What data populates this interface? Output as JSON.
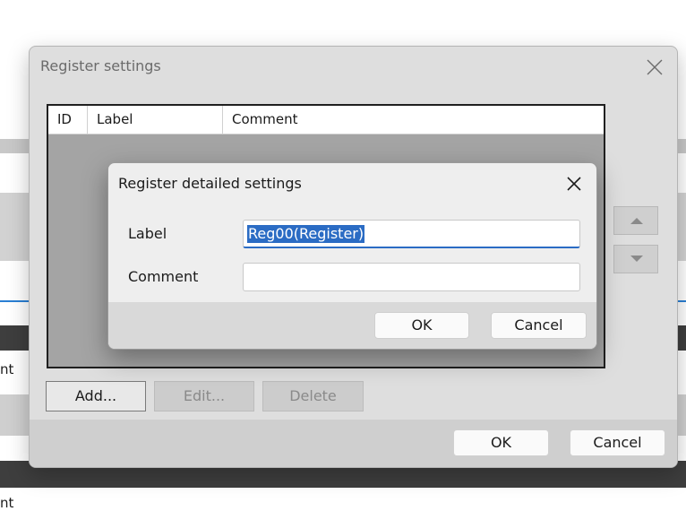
{
  "background": {
    "fragment_text_1": "nt",
    "fragment_text_2": "nt"
  },
  "outer_dialog": {
    "title": "Register settings",
    "close_icon": "close-icon",
    "table": {
      "columns": [
        "ID",
        "Label",
        "Comment"
      ]
    },
    "buttons": {
      "add": "Add...",
      "edit": "Edit...",
      "delete": "Delete",
      "ok": "OK",
      "cancel": "Cancel"
    },
    "side_buttons": {
      "up_icon": "triangle-up-icon",
      "down_icon": "triangle-down-icon"
    }
  },
  "inner_dialog": {
    "title": "Register detailed settings",
    "close_icon": "close-icon",
    "label_caption": "Label",
    "label_value": "Reg00(Register)",
    "comment_caption": "Comment",
    "comment_value": "",
    "ok": "OK",
    "cancel": "Cancel"
  },
  "colors": {
    "selection": "#2b6cc4",
    "accent_line": "#2a7fd4"
  }
}
